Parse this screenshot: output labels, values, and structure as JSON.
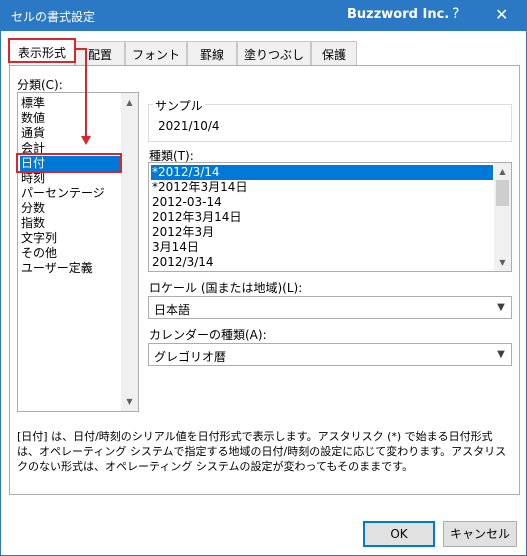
{
  "window": {
    "title": "セルの書式設定",
    "company": "Buzzword Inc.",
    "help_glyph": "?",
    "close_glyph": "✕"
  },
  "tabs": [
    {
      "label": "表示形式",
      "active": true
    },
    {
      "label": "配置"
    },
    {
      "label": "フォント"
    },
    {
      "label": "罫線"
    },
    {
      "label": "塗りつぶし"
    },
    {
      "label": "保護"
    }
  ],
  "category": {
    "label": "分類(C):",
    "items": [
      "標準",
      "数値",
      "通貨",
      "会計",
      "日付",
      "時刻",
      "パーセンテージ",
      "分数",
      "指数",
      "文字列",
      "その他",
      "ユーザー定義"
    ],
    "selected": "日付"
  },
  "sample": {
    "label": "サンプル",
    "value": "2021/10/4"
  },
  "type": {
    "label": "種類(T):",
    "items": [
      "*2012/3/14",
      "*2012年3月14日",
      "2012-03-14",
      "2012年3月14日",
      "2012年3月",
      "3月14日",
      "2012/3/14"
    ],
    "selected": "*2012/3/14"
  },
  "locale": {
    "label": "ロケール (国または地域)(L):",
    "value": "日本語"
  },
  "calendar": {
    "label": "カレンダーの種類(A):",
    "value": "グレゴリオ暦"
  },
  "description": "[日付] は、日付/時刻のシリアル値を日付形式で表示します。アスタリスク (*) で始まる日付形式は、オペレーティング システムで指定する地域の日付/時刻の設定に応じて変わります。アスタリスクのない形式は、オペレーティング システムの設定が変わってもそのままです。",
  "buttons": {
    "ok": "OK",
    "cancel": "キャンセル"
  },
  "colors": {
    "title_bar": "#2b78c5",
    "selection": "#0078d7",
    "highlight_annotation": "#d9262c"
  }
}
